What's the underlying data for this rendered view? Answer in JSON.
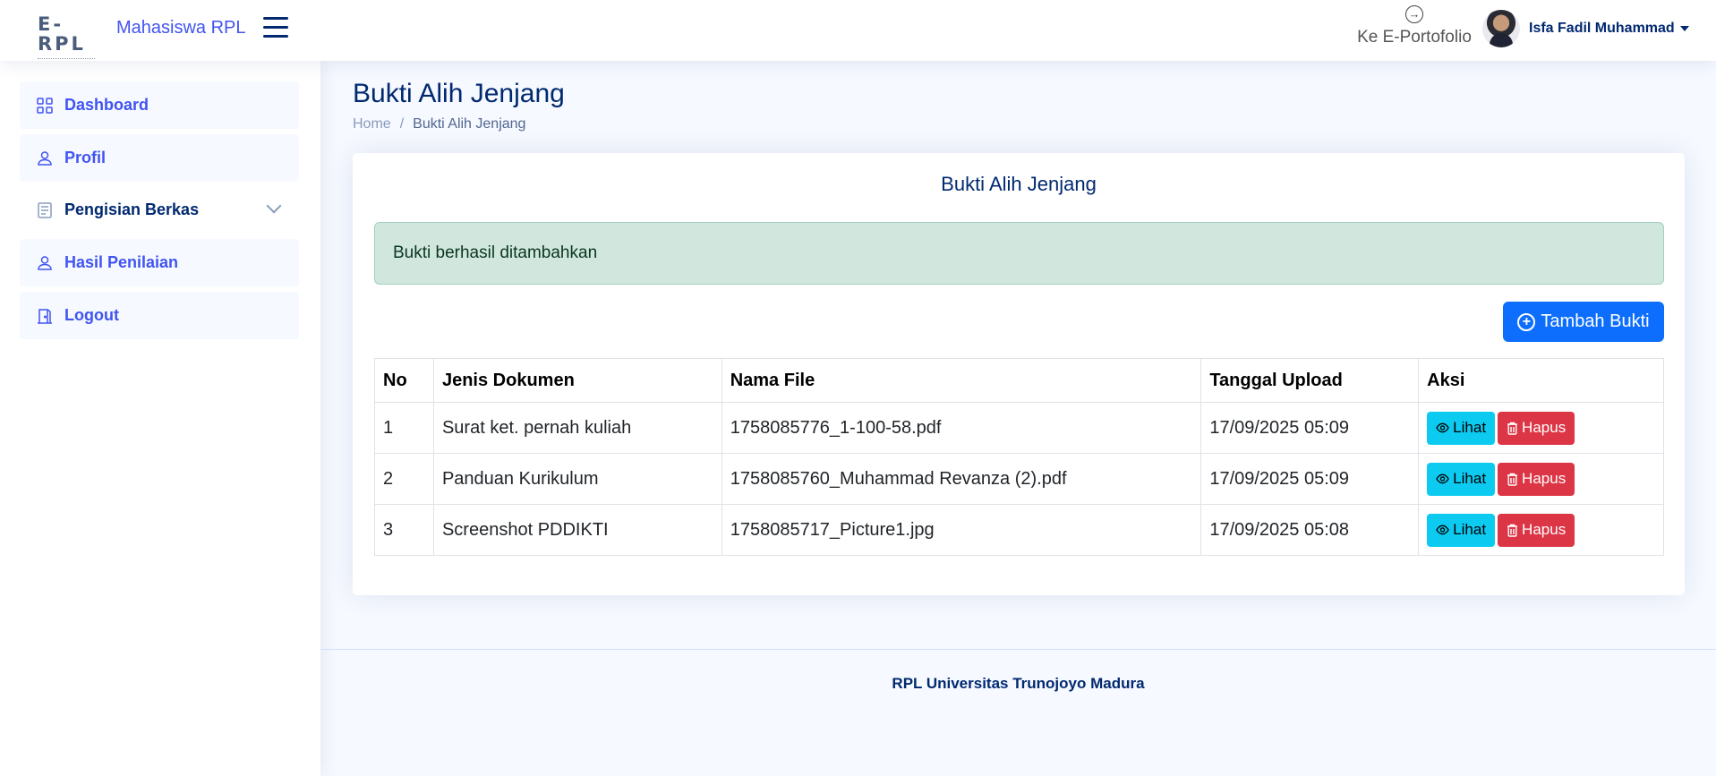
{
  "header": {
    "logo_text": "E-RPL",
    "app_name": "Mahasiswa RPL",
    "eportfolio_label": "Ke E-Portofolio",
    "user_name": "Isfa Fadil Muhammad"
  },
  "sidebar": {
    "items": [
      {
        "label": "Dashboard",
        "icon": "grid-icon"
      },
      {
        "label": "Profil",
        "icon": "person-icon"
      },
      {
        "label": "Pengisian Berkas",
        "icon": "document-list-icon"
      },
      {
        "label": "Hasil Penilaian",
        "icon": "person-icon"
      },
      {
        "label": "Logout",
        "icon": "door-icon"
      }
    ]
  },
  "page": {
    "title": "Bukti Alih Jenjang",
    "breadcrumb": [
      "Home",
      "/",
      "Bukti Alih Jenjang"
    ]
  },
  "card": {
    "title": "Bukti Alih Jenjang",
    "alert": "Bukti berhasil ditambahkan",
    "add_button": "Tambah Bukti"
  },
  "table": {
    "headers": [
      "No",
      "Jenis Dokumen",
      "Nama File",
      "Tanggal Upload",
      "Aksi"
    ],
    "rows": [
      {
        "no": "1",
        "jenis": "Surat ket. pernah kuliah",
        "nama": "1758085776_1-100-58.pdf",
        "tanggal": "17/09/2025 05:09",
        "view": "Lihat",
        "delete": "Hapus"
      },
      {
        "no": "2",
        "jenis": "Panduan Kurikulum",
        "nama": "1758085760_Muhammad Revanza (2).pdf",
        "tanggal": "17/09/2025 05:09",
        "view": "Lihat",
        "delete": "Hapus"
      },
      {
        "no": "3",
        "jenis": "Screenshot PDDIKTI",
        "nama": "1758085717_Picture1.jpg",
        "tanggal": "17/09/2025 05:08",
        "view": "Lihat",
        "delete": "Hapus"
      }
    ]
  },
  "footer": {
    "text": "RPL Universitas Trunojoyo Madura"
  },
  "colors": {
    "primary": "#4154f1",
    "navy": "#012970",
    "add_button": "#0d6efd",
    "view_button": "#0dcaf0",
    "delete_button": "#dc3545",
    "alert_bg": "#d1e7dd"
  }
}
